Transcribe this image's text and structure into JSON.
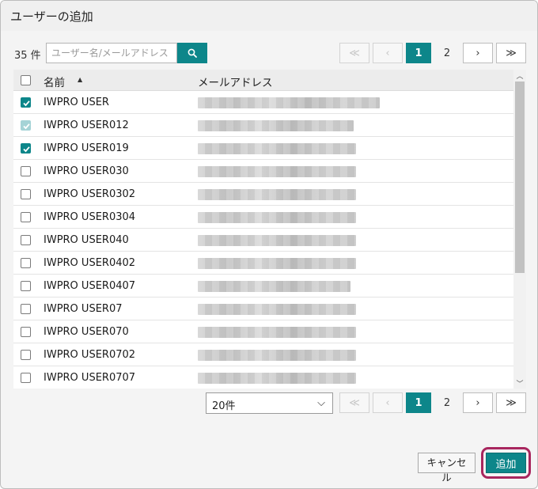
{
  "dialog": {
    "title": "ユーザーの追加"
  },
  "toolbar": {
    "count_label": "35 件",
    "search_placeholder": "ユーザー名/メールアドレス",
    "search_value": ""
  },
  "pagination": {
    "first": "≪",
    "prev": "‹",
    "pages": [
      "1",
      "2"
    ],
    "current_page": "1",
    "next": "›",
    "last": "≫"
  },
  "table": {
    "columns": {
      "name": "名前",
      "email": "メールアドレス"
    },
    "sort": {
      "column": "name",
      "direction": "ascending",
      "indicator": "▲"
    },
    "rows": [
      {
        "name": "IWPRO USER",
        "checked": true,
        "disabled": false
      },
      {
        "name": "IWPRO USER012",
        "checked": true,
        "disabled": true
      },
      {
        "name": "IWPRO USER019",
        "checked": true,
        "disabled": false
      },
      {
        "name": "IWPRO USER030",
        "checked": false,
        "disabled": false
      },
      {
        "name": "IWPRO USER0302",
        "checked": false,
        "disabled": false
      },
      {
        "name": "IWPRO USER0304",
        "checked": false,
        "disabled": false
      },
      {
        "name": "IWPRO USER040",
        "checked": false,
        "disabled": false
      },
      {
        "name": "IWPRO USER0402",
        "checked": false,
        "disabled": false
      },
      {
        "name": "IWPRO USER0407",
        "checked": false,
        "disabled": false
      },
      {
        "name": "IWPRO USER07",
        "checked": false,
        "disabled": false
      },
      {
        "name": "IWPRO USER070",
        "checked": false,
        "disabled": false
      },
      {
        "name": "IWPRO USER0702",
        "checked": false,
        "disabled": false
      },
      {
        "name": "IWPRO USER0707",
        "checked": false,
        "disabled": false
      }
    ]
  },
  "per_page": {
    "selected": "20件",
    "arrow": "⌵"
  },
  "scrollbar": {
    "up": "︿",
    "down": "﹀"
  },
  "footer": {
    "cancel_label": "キャンセル",
    "add_label": "追加"
  },
  "colors": {
    "accent": "#0d868a",
    "highlight": "#a8265e"
  },
  "icons": {
    "search": "search-icon",
    "sort": "sort-ascending-icon",
    "dropdown": "chevron-down-icon"
  }
}
